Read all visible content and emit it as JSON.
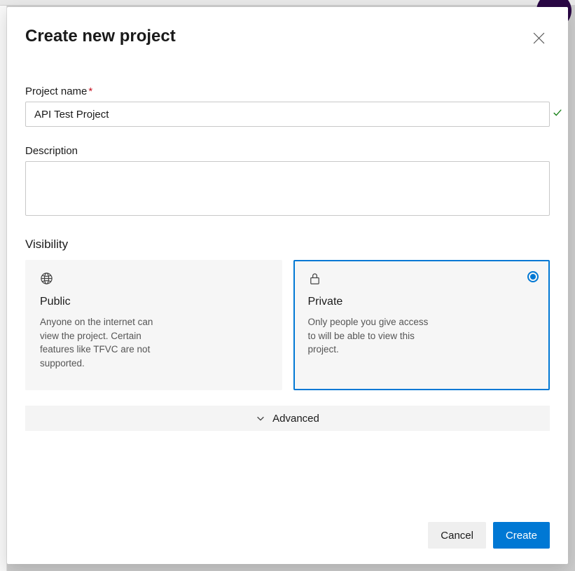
{
  "modal": {
    "title": "Create new project",
    "fields": {
      "project_name": {
        "label": "Project name",
        "value": "API Test Project",
        "required": true,
        "valid": true
      },
      "description": {
        "label": "Description",
        "value": ""
      }
    },
    "visibility": {
      "label": "Visibility",
      "selected": "private",
      "options": {
        "public": {
          "title": "Public",
          "description": "Anyone on the internet can view the project. Certain features like TFVC are not supported."
        },
        "private": {
          "title": "Private",
          "description": "Only people you give access to will be able to view this project."
        }
      }
    },
    "advanced_label": "Advanced",
    "buttons": {
      "cancel": "Cancel",
      "create": "Create"
    }
  }
}
